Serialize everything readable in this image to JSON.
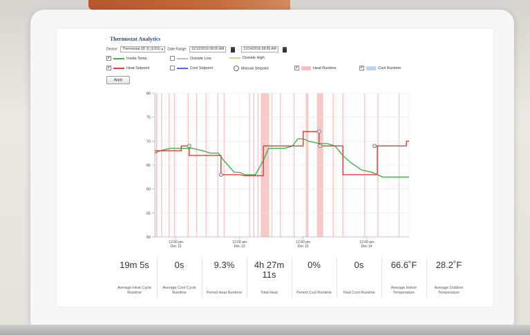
{
  "page": {
    "title": "Thermostat Analytics"
  },
  "filters": {
    "device_label": "Device:",
    "device_value": "Thermostat (ID 3) (1201)",
    "date_range_label": "Date Range:",
    "start_date": "12/12/2016 08:55 AM",
    "end_date": "12/14/2016 08:55 AM"
  },
  "legend": [
    {
      "label": "Inside Temp",
      "checked": true,
      "color": "#3cb44b",
      "kind": "line"
    },
    {
      "label": "Outside Low",
      "checked": false,
      "color": "#bbbbbb",
      "kind": "line"
    },
    {
      "label": "Outside High",
      "checked": false,
      "color": "#f2c58a",
      "kind": "line"
    },
    {
      "label": "Heat Setpoint",
      "checked": true,
      "color": "#e53a3a",
      "kind": "line"
    },
    {
      "label": "Cool Setpoint",
      "checked": false,
      "color": "#3a6fc4",
      "kind": "line"
    },
    {
      "label": "Manual Setpoint",
      "checked": false,
      "color": "#666666",
      "kind": "circle"
    },
    {
      "label": "Heat Runtime",
      "checked": true,
      "color": "#f5c2c2",
      "kind": "box"
    },
    {
      "label": "Cool Runtime",
      "checked": true,
      "color": "#bcd6f2",
      "kind": "box"
    }
  ],
  "apply_label": "Apply",
  "chart_data": {
    "type": "line",
    "ylim": [
      50,
      80
    ],
    "yticks": [
      80,
      75,
      70,
      65,
      60,
      55,
      50
    ],
    "xlim": [
      0,
      48
    ],
    "xticks": [
      {
        "x": 4,
        "line1": "12:00 pm",
        "line2": "Dec 12"
      },
      {
        "x": 16,
        "line1": "12:00 am",
        "line2": "Dec 13"
      },
      {
        "x": 28,
        "line1": "12:00 pm",
        "line2": "Dec 13"
      },
      {
        "x": 40,
        "line1": "12:00 am",
        "line2": "Dec 14"
      }
    ],
    "series": [
      {
        "name": "Inside Temp",
        "color": "#3cb44b",
        "x": [
          0,
          1,
          3,
          5,
          7,
          9,
          10.5,
          12,
          13,
          15,
          16,
          17,
          17.5,
          19,
          20.5,
          21.5,
          23,
          24.5,
          26,
          27,
          28,
          29,
          31,
          32.5,
          34,
          35.5,
          37,
          39,
          41,
          43,
          45,
          48
        ],
        "values": [
          67.5,
          68,
          68.5,
          68.5,
          68.5,
          68,
          67.5,
          67.5,
          66,
          63.5,
          63.5,
          63,
          63,
          63,
          66,
          68.5,
          68.5,
          68.5,
          69,
          70.5,
          70.5,
          70,
          69.5,
          69.5,
          69,
          67,
          65.5,
          64,
          63.5,
          62.5,
          62.5,
          62.5
        ]
      },
      {
        "name": "Heat Setpoint",
        "color": "#e53a3a",
        "x": [
          0,
          5,
          5,
          6.5,
          6.5,
          12.5,
          12.5,
          15,
          15,
          16,
          16,
          17,
          17,
          20.5,
          20.5,
          28,
          28,
          31,
          31,
          35.5,
          35.5,
          41.5,
          41.5,
          42,
          42,
          47.5,
          47.5,
          48
        ],
        "values": [
          68,
          68,
          69,
          69,
          67,
          67,
          63,
          63,
          63,
          63,
          63,
          62.8,
          62.8,
          62.8,
          69,
          69,
          72,
          72,
          69,
          69,
          63,
          63,
          63,
          63,
          69,
          69,
          70,
          70
        ]
      }
    ],
    "manual_setpoints": [
      {
        "x": 6.5,
        "value": 69
      },
      {
        "x": 12.5,
        "value": 63
      },
      {
        "x": 31,
        "value": 72
      },
      {
        "x": 31.2,
        "value": 69
      },
      {
        "x": 41.5,
        "value": 69
      }
    ],
    "heat_runtime_intervals": [
      [
        0.2,
        0.5
      ],
      [
        1.2,
        1.4
      ],
      [
        2.6,
        2.8
      ],
      [
        3.6,
        3.8
      ],
      [
        6.2,
        6.4
      ],
      [
        7.8,
        8.0
      ],
      [
        9.6,
        9.8
      ],
      [
        11.8,
        12.0
      ],
      [
        13.0,
        13.2
      ],
      [
        17.8,
        18.0
      ],
      [
        18.6,
        18.8
      ],
      [
        19.4,
        19.6
      ],
      [
        20.0,
        21.6
      ],
      [
        22.0,
        22.2
      ],
      [
        23.6,
        23.8
      ],
      [
        26.2,
        26.4
      ],
      [
        28.5,
        29.0
      ],
      [
        30.6,
        31.8
      ],
      [
        33.6,
        33.8
      ],
      [
        35.4,
        35.6
      ],
      [
        39.5,
        39.7
      ],
      [
        42.0,
        42.2
      ],
      [
        46.0,
        46.2
      ]
    ]
  },
  "stats": [
    {
      "value": "19m 5s",
      "label": "Average Heat Cycle Runtime"
    },
    {
      "value": "0s",
      "label": "Average Cool Cycle Runtime"
    },
    {
      "value": "9.3%",
      "label": "Period Heat Runtime"
    },
    {
      "value": "4h 27m 11s",
      "label": "Total Heat"
    },
    {
      "value": "0%",
      "label": "Period Cool Runtime"
    },
    {
      "value": "0s",
      "label": "Total Cool Runtime"
    },
    {
      "value": "66.6˚F",
      "label": "Average Indoor Temperature"
    },
    {
      "value": "28.2˚F",
      "label": "Average Outdoor Temperature"
    }
  ]
}
